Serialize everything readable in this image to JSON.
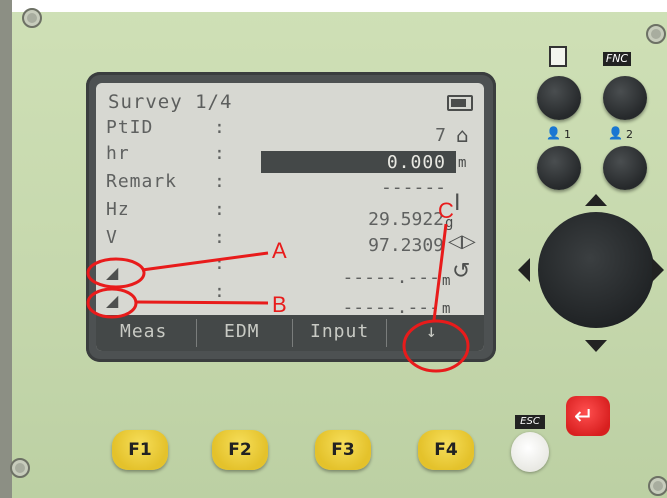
{
  "screen": {
    "title": "Survey 1/4",
    "rows": [
      {
        "label": "PtID",
        "colon": ":",
        "value": "7",
        "unit": ""
      },
      {
        "label": "hr",
        "colon": ":",
        "value": "0.000",
        "unit": "m"
      },
      {
        "label": "Remark",
        "colon": ":",
        "value": "------",
        "unit": ""
      },
      {
        "label": "Hz",
        "colon": ":",
        "value": "29.5922",
        "unit": "g"
      },
      {
        "label": "V",
        "colon": ":",
        "value": "97.2309",
        "unit": "g"
      },
      {
        "label": "",
        "colon": ":",
        "value": "-----.---",
        "unit": "m"
      },
      {
        "label": "",
        "colon": ":",
        "value": "-----.---",
        "unit": "m"
      }
    ],
    "softkeys": [
      "Meas",
      "EDM",
      "Input",
      "↓"
    ]
  },
  "keys": {
    "function": [
      "F1",
      "F2",
      "F3",
      "F4"
    ],
    "esc_label": "ESC",
    "fnc_label": "FNC",
    "enter_glyph": "↵",
    "user1_label": "1",
    "user2_label": "2"
  },
  "annotations": {
    "a": "A",
    "b": "B",
    "c": "C"
  },
  "colors": {
    "panel": "#c6d8ad",
    "lcd": "#d7d8d2",
    "softbar": "#444848",
    "fkey": "#e4c22b",
    "annotation": "#e81b1b",
    "enter": "#d81f1f"
  },
  "icons": [
    "battery-icon",
    "house-icon",
    "i-beam-icon",
    "prism-icon",
    "undo-arrow-icon",
    "document-icon",
    "user-icon",
    "dpad-arrow-icon"
  ]
}
